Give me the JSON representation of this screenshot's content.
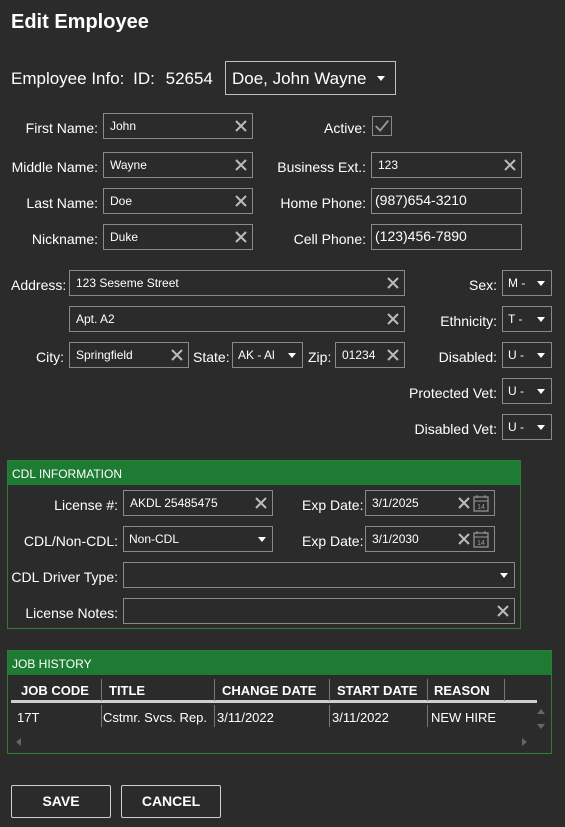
{
  "title": "Edit Employee",
  "employee_info": {
    "label": "Employee Info:",
    "id_label": "ID:",
    "id": "52654",
    "selected": "Doe, John Wayne"
  },
  "fields": {
    "first_name": {
      "label": "First Name:",
      "value": "John"
    },
    "middle_name": {
      "label": "Middle Name:",
      "value": "Wayne"
    },
    "last_name": {
      "label": "Last Name:",
      "value": "Doe"
    },
    "nickname": {
      "label": "Nickname:",
      "value": "Duke"
    },
    "active": {
      "label": "Active:",
      "checked": true
    },
    "business_ext": {
      "label": "Business Ext.:",
      "value": "123"
    },
    "home_phone": {
      "label": "Home Phone:",
      "value": "(987)654-3210"
    },
    "cell_phone": {
      "label": "Cell Phone:",
      "value": "(123)456-7890"
    },
    "address": {
      "label": "Address:",
      "line1": "123 Seseme Street",
      "line2": "Apt. A2"
    },
    "city": {
      "label": "City:",
      "value": "Springfield"
    },
    "state": {
      "label": "State:",
      "value": "AK - Al"
    },
    "zip": {
      "label": "Zip:",
      "value": "01234"
    },
    "sex": {
      "label": "Sex:",
      "value": "M -"
    },
    "ethnicity": {
      "label": "Ethnicity:",
      "value": "T -"
    },
    "disabled": {
      "label": "Disabled:",
      "value": "U -"
    },
    "protected_vet": {
      "label": "Protected Vet:",
      "value": "U -"
    },
    "disabled_vet": {
      "label": "Disabled Vet:",
      "value": "U -"
    }
  },
  "cdl": {
    "header": "CDL INFORMATION",
    "license_label": "License #:",
    "license_value": "AKDL 25485475",
    "exp1_label": "Exp Date:",
    "exp1_value": "3/1/2025",
    "type_label": "CDL/Non-CDL:",
    "type_value": "Non-CDL",
    "exp2_label": "Exp Date:",
    "exp2_value": "3/1/2030",
    "driver_type_label": "CDL Driver Type:",
    "driver_type_value": "",
    "notes_label": "License Notes:",
    "notes_value": ""
  },
  "job_history": {
    "header": "JOB HISTORY",
    "columns": [
      "JOB CODE",
      "TITLE",
      "CHANGE DATE",
      "START DATE",
      "REASON"
    ],
    "rows": [
      [
        "17T",
        "Cstmr. Svcs. Rep.",
        "3/11/2022",
        "3/11/2022",
        "NEW HIRE"
      ]
    ]
  },
  "buttons": {
    "save": "SAVE",
    "cancel": "CANCEL"
  },
  "colors": {
    "background": "#2b2b2b",
    "panel_header": "#1e7b34",
    "border": "#8a8a8a"
  }
}
